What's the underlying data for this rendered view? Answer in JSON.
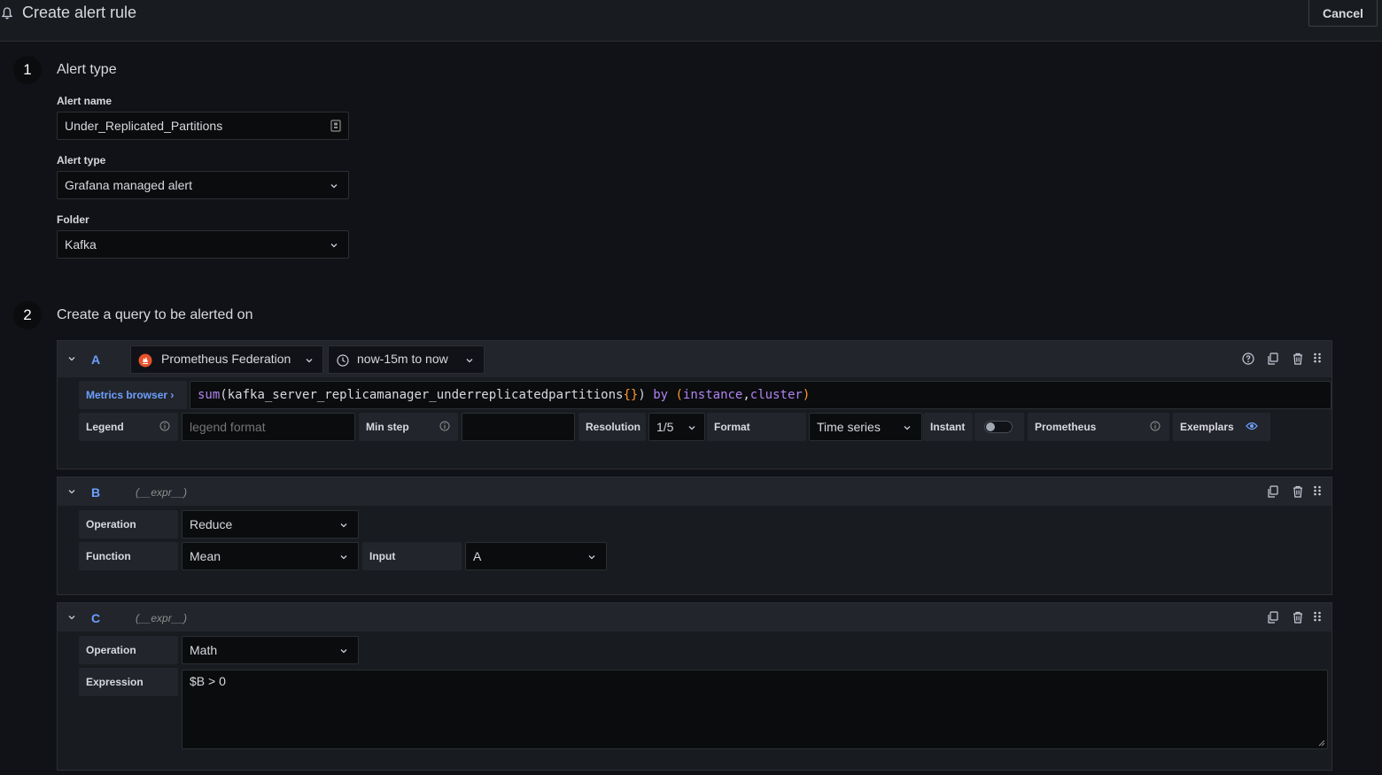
{
  "header": {
    "title": "Create alert rule",
    "cancel_label": "Cancel"
  },
  "step1": {
    "number": "1",
    "title": "Alert type",
    "alert_name_label": "Alert name",
    "alert_name_value": "Under_Replicated_Partitions",
    "alert_type_label": "Alert type",
    "alert_type_value": "Grafana managed alert",
    "folder_label": "Folder",
    "folder_value": "Kafka"
  },
  "step2": {
    "number": "2",
    "title": "Create a query to be alerted on"
  },
  "query_a": {
    "letter": "A",
    "datasource": "Prometheus Federation",
    "time_range": "now-15m to now",
    "metrics_browser": "Metrics browser ›",
    "query_fn": "sum",
    "query_metric": "kafka_server_replicamanager_underreplicatedpartitions",
    "query_braces": "{}",
    "query_by": "by",
    "query_label1": "instance",
    "query_label2": "cluster",
    "legend_label": "Legend",
    "legend_placeholder": "legend format",
    "min_step_label": "Min step",
    "resolution_label": "Resolution",
    "resolution_value": "1/5",
    "format_label": "Format",
    "format_value": "Time series",
    "instant_label": "Instant",
    "instant_on": false,
    "prometheus_label": "Prometheus",
    "exemplars_label": "Exemplars"
  },
  "query_b": {
    "letter": "B",
    "expr": "(__expr__)",
    "operation_label": "Operation",
    "operation_value": "Reduce",
    "function_label": "Function",
    "function_value": "Mean",
    "input_label": "Input",
    "input_value": "A"
  },
  "query_c": {
    "letter": "C",
    "expr": "(__expr__)",
    "operation_label": "Operation",
    "operation_value": "Math",
    "expression_label": "Expression",
    "expression_value": "$B > 0"
  },
  "colors": {
    "accent": "#6e9fff",
    "bg": "#111217",
    "panel": "#181b1f",
    "prometheus": "#e6522c"
  }
}
